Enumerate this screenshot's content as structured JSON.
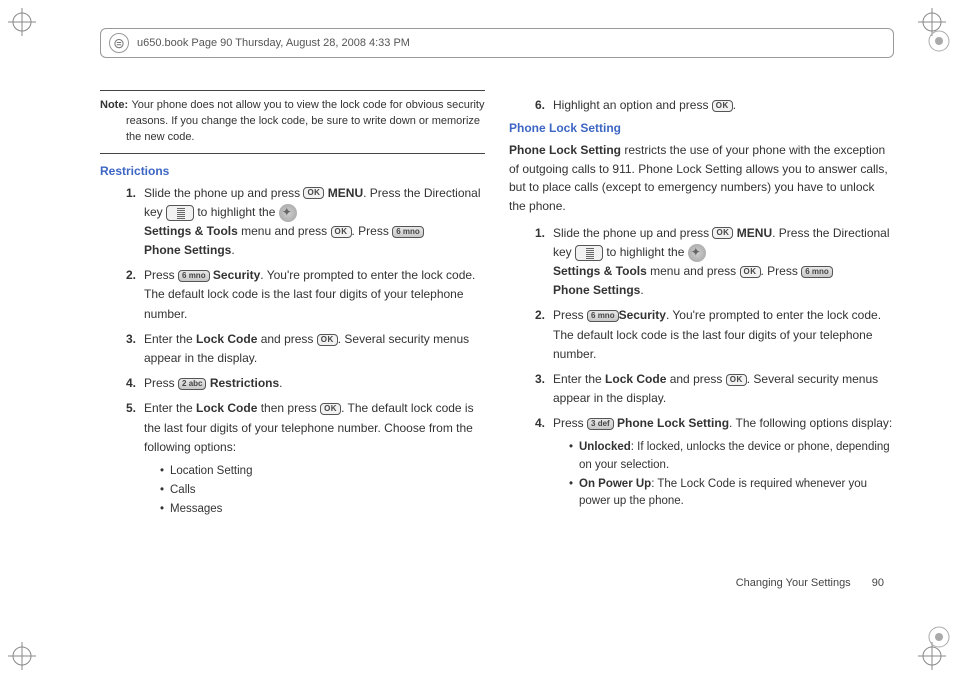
{
  "header": {
    "text": "u650.book  Page 90  Thursday, August 28, 2008  4:33 PM"
  },
  "left": {
    "note_label": "Note:",
    "note_text": "Your phone does not allow you to view the lock code for obvious security reasons. If you change the lock code, be sure to write down or memorize the new code.",
    "section_title": "Restrictions",
    "step1_a": "Slide the phone up and press ",
    "step1_menu": " MENU",
    "step1_b": ". Press the Directional key ",
    "step1_c": " to highlight the ",
    "step1_settings": "Settings & Tools",
    "step1_d": " menu and press ",
    "step1_e": ". Press ",
    "step1_phone": "Phone Settings",
    "step1_f": ".",
    "step2_a": "Press ",
    "step2_sec": " Security",
    "step2_b": ". You're prompted to enter the lock code. The default lock code is the last four digits of your telephone number.",
    "step3_a": "Enter the ",
    "step3_lc": "Lock Code",
    "step3_b": " and press ",
    "step3_c": ". Several security menus appear in the display.",
    "step4_a": "Press ",
    "step4_res": " Restrictions",
    "step4_b": ".",
    "step5_a": "Enter the ",
    "step5_lc": "Lock Code",
    "step5_b": " then press ",
    "step5_c": ". The default lock code is the last four digits of your telephone number. Choose from the following options:",
    "bul1": "Location Setting",
    "bul2": "Calls",
    "bul3": "Messages"
  },
  "right": {
    "step6_a": "Highlight an option and press ",
    "step6_b": ".",
    "section_title": "Phone Lock Setting",
    "intro_b": "Phone Lock Setting",
    "intro": " restricts the use of your phone with the exception of outgoing calls to 911. Phone Lock Setting allows you to answer calls, but to place calls (except to emergency numbers) you have to unlock the phone.",
    "step1_a": "Slide the phone up and press ",
    "step1_menu": " MENU",
    "step1_b": ". Press the Directional key ",
    "step1_c": " to highlight the ",
    "step1_settings": "Settings & Tools",
    "step1_d": " menu and press ",
    "step1_e": ". Press ",
    "step1_phone": "Phone Settings",
    "step1_f": ".",
    "step2_a": "Press ",
    "step2_sec": "Security",
    "step2_b": ". You're prompted to enter the lock code. The default lock code is the last four digits of your telephone number.",
    "step3_a": "Enter the ",
    "step3_lc": "Lock Code",
    "step3_b": " and press ",
    "step3_c": ". Several security menus appear in the display.",
    "step4_a": "Press ",
    "step4_pls": " Phone Lock Setting",
    "step4_b": ". The following options display:",
    "bul1b": "Unlocked",
    "bul1t": ": If locked, unlocks the device or phone, depending on your selection.",
    "bul2b": "On Power Up",
    "bul2t": ": The Lock Code is required whenever you power up the phone."
  },
  "footer": {
    "label": "Changing Your Settings",
    "page": "90"
  },
  "keys": {
    "ok": "OK",
    "k6": "6 mno",
    "k2": "2 abc",
    "k3": "3 def"
  }
}
